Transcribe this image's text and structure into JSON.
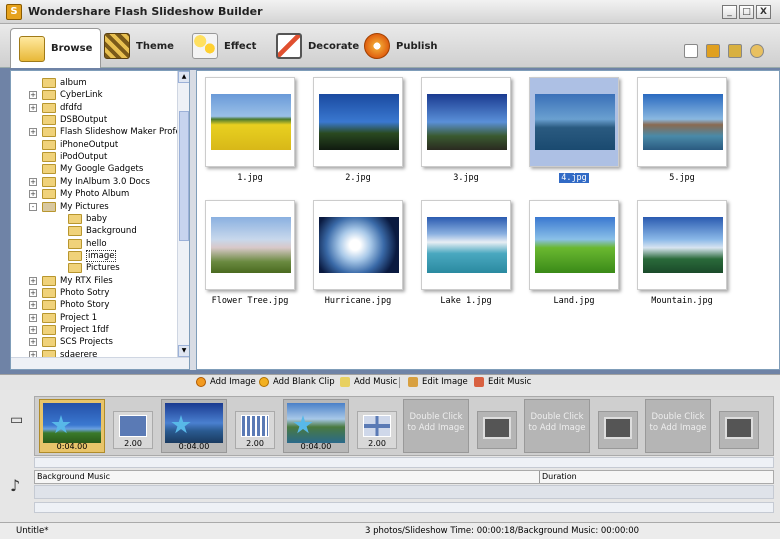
{
  "window": {
    "title": "Wondershare  Flash Slideshow Builder",
    "app_icon": "S",
    "min": "_",
    "max": "□",
    "close": "X"
  },
  "tabs": [
    {
      "label": "Browse"
    },
    {
      "label": "Theme"
    },
    {
      "label": "Effect"
    },
    {
      "label": "Decorate"
    },
    {
      "label": "Publish"
    }
  ],
  "tree": {
    "items": [
      {
        "label": "album",
        "exp": ""
      },
      {
        "label": "CyberLink",
        "exp": "+"
      },
      {
        "label": "dfdfd",
        "exp": "+"
      },
      {
        "label": "DSBOutput",
        "exp": ""
      },
      {
        "label": "Flash Slideshow Maker Professic",
        "exp": "+"
      },
      {
        "label": "iPhoneOutput",
        "exp": ""
      },
      {
        "label": "iPodOutput",
        "exp": ""
      },
      {
        "label": "My Google Gadgets",
        "exp": ""
      },
      {
        "label": "My InAlbum 3.0 Docs",
        "exp": "+"
      },
      {
        "label": "My Photo Album",
        "exp": "+"
      },
      {
        "label": "My Pictures",
        "exp": "-"
      },
      {
        "label": "baby",
        "exp": ""
      },
      {
        "label": "Background",
        "exp": ""
      },
      {
        "label": "hello",
        "exp": ""
      },
      {
        "label": "image",
        "exp": ""
      },
      {
        "label": "Pictures",
        "exp": ""
      },
      {
        "label": "My RTX Files",
        "exp": "+"
      },
      {
        "label": "Photo Sotry",
        "exp": "+"
      },
      {
        "label": "Photo Story",
        "exp": "+"
      },
      {
        "label": "Project 1",
        "exp": "+"
      },
      {
        "label": "Project 1fdf",
        "exp": "+"
      },
      {
        "label": "SCS Projects",
        "exp": "+"
      },
      {
        "label": "sdaerere",
        "exp": "+"
      }
    ]
  },
  "images": [
    {
      "label": "1.jpg"
    },
    {
      "label": "2.jpg"
    },
    {
      "label": "3.jpg"
    },
    {
      "label": "4.jpg"
    },
    {
      "label": "5.jpg"
    },
    {
      "label": "Flower Tree.jpg"
    },
    {
      "label": "Hurricane.jpg"
    },
    {
      "label": "Lake 1.jpg"
    },
    {
      "label": "Land.jpg"
    },
    {
      "label": "Mountain.jpg"
    }
  ],
  "actions": [
    {
      "label": "Add Image"
    },
    {
      "label": "Add Blank Clip"
    },
    {
      "label": "Add Music"
    },
    {
      "label": "Edit Image"
    },
    {
      "label": "Edit Music"
    }
  ],
  "timeline": {
    "clips": [
      {
        "duration": "0:04.00"
      },
      {
        "duration": "0:04.00"
      },
      {
        "duration": "0:04.00"
      }
    ],
    "transitions": [
      "2.00",
      "2.00",
      "2.00"
    ],
    "empty_label": "Double Click to Add Image",
    "music_header": "Background Music",
    "duration_header": "Duration",
    "film_icon": "▭",
    "note_icon": "♪"
  },
  "status": {
    "left": "Untitle*",
    "center": "3 photos/Slideshow Time: 00:00:18/Background Music: 00:00:00"
  }
}
